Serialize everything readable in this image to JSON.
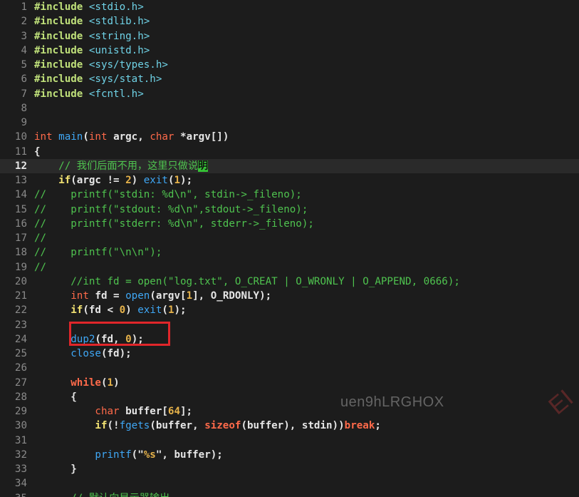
{
  "editor": {
    "current_line": 12,
    "lines": [
      {
        "n": "1",
        "t": [
          [
            "pre",
            "#include "
          ],
          [
            "hdr",
            "<stdio.h>"
          ]
        ]
      },
      {
        "n": "2",
        "t": [
          [
            "pre",
            "#include "
          ],
          [
            "hdr",
            "<stdlib.h>"
          ]
        ]
      },
      {
        "n": "3",
        "t": [
          [
            "pre",
            "#include "
          ],
          [
            "hdr",
            "<string.h>"
          ]
        ]
      },
      {
        "n": "4",
        "t": [
          [
            "pre",
            "#include "
          ],
          [
            "hdr",
            "<unistd.h>"
          ]
        ]
      },
      {
        "n": "5",
        "t": [
          [
            "pre",
            "#include "
          ],
          [
            "hdr",
            "<sys/types.h>"
          ]
        ]
      },
      {
        "n": "6",
        "t": [
          [
            "pre",
            "#include "
          ],
          [
            "hdr",
            "<sys/stat.h>"
          ]
        ]
      },
      {
        "n": "7",
        "t": [
          [
            "pre",
            "#include "
          ],
          [
            "hdr",
            "<fcntl.h>"
          ]
        ]
      },
      {
        "n": "8",
        "t": []
      },
      {
        "n": "9",
        "t": []
      },
      {
        "n": "10",
        "t": [
          [
            "type",
            "int "
          ],
          [
            "fn",
            "main"
          ],
          [
            "id",
            "("
          ],
          [
            "type",
            "int "
          ],
          [
            "id",
            "argc, "
          ],
          [
            "type",
            "char "
          ],
          [
            "id",
            "*argv[])"
          ]
        ]
      },
      {
        "n": "11",
        "t": [
          [
            "id",
            "{"
          ]
        ]
      },
      {
        "n": "12",
        "t": [
          [
            "cm",
            "    // 我们后面不用，这里只做说"
          ],
          [
            "cur",
            "明"
          ]
        ]
      },
      {
        "n": "13",
        "t": [
          [
            "kw",
            "    if"
          ],
          [
            "id",
            "(argc != "
          ],
          [
            "num",
            "2"
          ],
          [
            "id",
            ") "
          ],
          [
            "fn",
            "exit"
          ],
          [
            "id",
            "("
          ],
          [
            "num",
            "1"
          ],
          [
            "id",
            ");"
          ]
        ]
      },
      {
        "n": "14",
        "t": [
          [
            "cm",
            "//    printf(\"stdin: %d\\n\", stdin->_fileno);"
          ]
        ]
      },
      {
        "n": "15",
        "t": [
          [
            "cm",
            "//    printf(\"stdout: %d\\n\",stdout->_fileno);"
          ]
        ]
      },
      {
        "n": "16",
        "t": [
          [
            "cm",
            "//    printf(\"stderr: %d\\n\", stderr->_fileno);"
          ]
        ]
      },
      {
        "n": "17",
        "t": [
          [
            "cm",
            "//"
          ]
        ]
      },
      {
        "n": "18",
        "t": [
          [
            "cm",
            "//    printf(\"\\n\\n\");"
          ]
        ]
      },
      {
        "n": "19",
        "t": [
          [
            "cm",
            "//"
          ]
        ]
      },
      {
        "n": "20",
        "t": [
          [
            "cm",
            "      //int fd = open(\"log.txt\", O_CREAT | O_WRONLY | O_APPEND, 0666);"
          ]
        ]
      },
      {
        "n": "21",
        "t": [
          [
            "type",
            "      int "
          ],
          [
            "id",
            "fd = "
          ],
          [
            "fn",
            "open"
          ],
          [
            "id",
            "(argv["
          ],
          [
            "num",
            "1"
          ],
          [
            "id",
            "], O_RDONLY);"
          ]
        ]
      },
      {
        "n": "22",
        "t": [
          [
            "kw",
            "      if"
          ],
          [
            "id",
            "(fd < "
          ],
          [
            "num",
            "0"
          ],
          [
            "id",
            ") "
          ],
          [
            "fn",
            "exit"
          ],
          [
            "id",
            "("
          ],
          [
            "num",
            "1"
          ],
          [
            "id",
            ");"
          ]
        ]
      },
      {
        "n": "23",
        "t": []
      },
      {
        "n": "24",
        "t": [
          [
            "fn",
            "      dup2"
          ],
          [
            "id",
            "(fd, "
          ],
          [
            "num",
            "0"
          ],
          [
            "id",
            ");"
          ]
        ]
      },
      {
        "n": "25",
        "t": [
          [
            "fn",
            "      close"
          ],
          [
            "id",
            "(fd);"
          ]
        ]
      },
      {
        "n": "26",
        "t": []
      },
      {
        "n": "27",
        "t": [
          [
            "kwr",
            "      while"
          ],
          [
            "id",
            "("
          ],
          [
            "num",
            "1"
          ],
          [
            "id",
            ")"
          ]
        ]
      },
      {
        "n": "28",
        "t": [
          [
            "id",
            "      {"
          ]
        ]
      },
      {
        "n": "29",
        "t": [
          [
            "type",
            "          char "
          ],
          [
            "id",
            "buffer["
          ],
          [
            "num",
            "64"
          ],
          [
            "id",
            "];"
          ]
        ]
      },
      {
        "n": "30",
        "t": [
          [
            "kw",
            "          if"
          ],
          [
            "id",
            "(!"
          ],
          [
            "fn",
            "fgets"
          ],
          [
            "id",
            "(buffer, "
          ],
          [
            "kwr",
            "sizeof"
          ],
          [
            "id",
            "(buffer), stdin))"
          ],
          [
            "kwr",
            "break"
          ],
          [
            "id",
            ";"
          ]
        ]
      },
      {
        "n": "31",
        "t": []
      },
      {
        "n": "32",
        "t": [
          [
            "fn",
            "          printf"
          ],
          [
            "id",
            "(\""
          ],
          [
            "num",
            "%s"
          ],
          [
            "id",
            "\", buffer);"
          ]
        ]
      },
      {
        "n": "33",
        "t": [
          [
            "id",
            "      }"
          ]
        ]
      },
      {
        "n": "34",
        "t": []
      },
      {
        "n": "35",
        "t": [
          [
            "cm",
            "      // 默认向显示器输出"
          ]
        ]
      }
    ]
  },
  "watermark": "uen9hLRGHOX",
  "watermark_corner": "EI",
  "colors": {
    "background": "#1c1c1c",
    "highlight_box": "#e0262a"
  }
}
